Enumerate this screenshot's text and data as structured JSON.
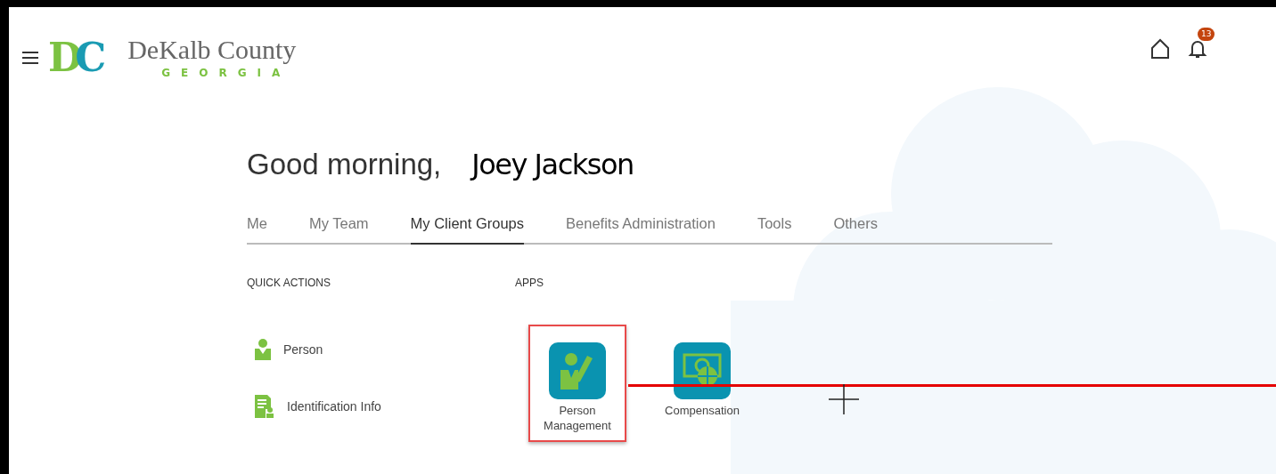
{
  "header": {
    "logo_letters": "DC",
    "logo_name": "DeKalb County",
    "logo_state": "GEORGIA",
    "notifications_count": "13"
  },
  "greeting": {
    "text": "Good morning,",
    "name": "Joey Jackson"
  },
  "tabs": [
    {
      "label": "Me",
      "selected": false
    },
    {
      "label": "My Team",
      "selected": false
    },
    {
      "label": "My Client Groups",
      "selected": true
    },
    {
      "label": "Benefits Administration",
      "selected": false
    },
    {
      "label": "Tools",
      "selected": false
    },
    {
      "label": "Others",
      "selected": false
    }
  ],
  "quick_actions": {
    "title": "QUICK ACTIONS",
    "items": [
      {
        "label": "Person",
        "kind": "person"
      },
      {
        "label": "Identification Info",
        "kind": "document"
      }
    ]
  },
  "apps": {
    "title": "APPS",
    "items": [
      {
        "label": "Person Management",
        "kind": "person-edit",
        "selected": true
      },
      {
        "label": "Compensation",
        "kind": "money",
        "selected": false
      }
    ]
  }
}
